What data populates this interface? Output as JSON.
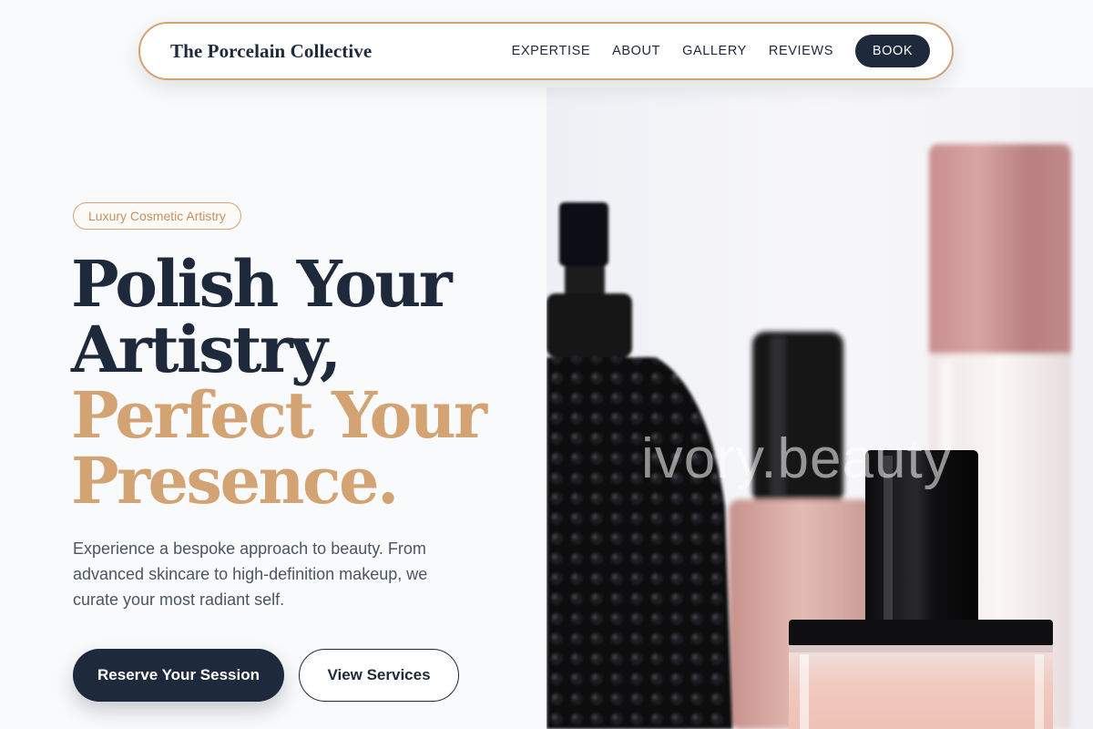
{
  "nav": {
    "brand": "The Porcelain Collective",
    "links": [
      "EXPERTISE",
      "ABOUT",
      "GALLERY",
      "REVIEWS"
    ],
    "cta": "BOOK"
  },
  "hero": {
    "tag": "Luxury Cosmetic Artistry",
    "headline": {
      "line1": "Polish Your",
      "line2": "Artistry,",
      "line3": "Perfect Your",
      "line4": "Presence."
    },
    "subtext": "Experience a bespoke approach to beauty. From advanced skincare to high-definition makeup, we curate your most radiant self.",
    "primary_cta": "Reserve Your Session",
    "secondary_cta": "View Services"
  },
  "image": {
    "subject": "perfume-and-cosmetic-bottles",
    "watermark": "ivory.beauty"
  },
  "colors": {
    "navy": "#1e293b",
    "gold": "#d4a373",
    "text_muted": "#4b5563",
    "background": "#f9fafb"
  }
}
